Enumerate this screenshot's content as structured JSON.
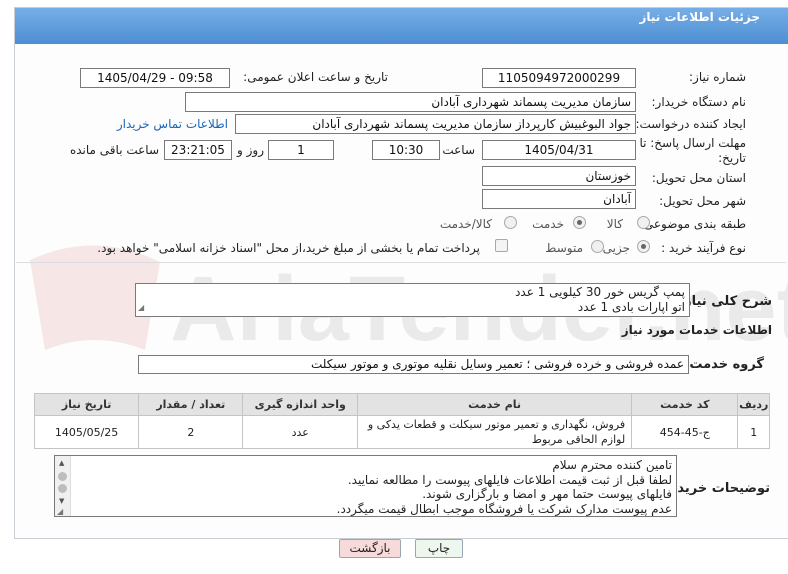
{
  "header": {
    "title": "جزئیات اطلاعات نیاز"
  },
  "labels": {
    "need_number": "شماره نیاز:",
    "announce_datetime": "تاریخ و ساعت اعلان عمومی:",
    "buyer_org": "نام دستگاه خریدار:",
    "requester": "ایجاد کننده درخواست:",
    "contact_link": "اطلاعات تماس خریدار",
    "deadline": "مهلت ارسال پاسخ: تا تاریخ:",
    "time_word": "ساعت",
    "day_and": "روز و",
    "remaining": "ساعت باقی مانده",
    "province": "استان محل تحویل:",
    "city": "شهر محل تحویل:",
    "category": "طبقه بندی موضوعی:",
    "process_type": "نوع فرآیند خرید :",
    "general_desc": "شرح کلی نیاز:",
    "services_info": "اطلاعات خدمات مورد نیاز",
    "service_group": "گروه خدمت:",
    "buyer_notes": "توضیحات خریدار:"
  },
  "fields": {
    "need_number": "1105094972000299",
    "announce_datetime": "1405/04/29 - 09:58",
    "buyer_org": "سازمان مدیریت پسماند شهرداری آبادان",
    "requester": "جواد البوغبیش کارپرداز سازمان مدیریت پسماند شهرداری آبادان",
    "deadline_date": "1405/04/31",
    "deadline_time": "10:30",
    "days": "1",
    "remaining_time": "23:21:05",
    "province": "خوزستان",
    "city": "آبادان",
    "service_group": "عمده فروشی و خرده فروشی ؛ تعمیر وسایل نقلیه موتوری و موتور سیکلت"
  },
  "category_options": [
    {
      "label": "کالا",
      "selected": false
    },
    {
      "label": "خدمت",
      "selected": true
    },
    {
      "label": "کالا/خدمت",
      "selected": false
    }
  ],
  "process_options": [
    {
      "label": "جزیی",
      "selected": true
    },
    {
      "label": "متوسط",
      "selected": false
    }
  ],
  "payment_note": "پرداخت تمام یا بخشی از مبلغ خرید،از محل \"اسناد خزانه اسلامی\" خواهد بود.",
  "general_desc": {
    "line1": "پمپ گریس خور 30 کیلویی 1 عدد",
    "line2": "اتو اپارات بادی 1 عدد"
  },
  "table": {
    "headers": {
      "row": "ردیف",
      "code": "کد خدمت",
      "name": "نام خدمت",
      "unit": "واحد اندازه گیری",
      "qty": "تعداد / مقدار",
      "date": "تاریخ نیاز"
    },
    "rows": [
      {
        "row": "1",
        "code": "ج-45-454",
        "name": "فروش، نگهداری و تعمیر موتور سیکلت و قطعات یدکی و لوازم الحاقی مربوط",
        "unit": "عدد",
        "qty": "2",
        "date": "1405/05/25"
      }
    ]
  },
  "buyer_notes": {
    "l1": "تامین کننده محترم سلام",
    "l2": "لطفا قبل از ثبت قیمت اطلاعات فایلهای پیوست را مطالعه نمایید.",
    "l3": "فایلهای پیوست حتما مهر و امضا و بارگزاری شوند.",
    "l4": "عدم پیوست مدارک شرکت یا فروشگاه موجب ابطال قیمت میگردد."
  },
  "buttons": {
    "print": "چاپ",
    "back": "بازگشت"
  },
  "watermark": "AriaTender.net",
  "colors": {
    "header": "#5b98d8",
    "link": "#1a66b8",
    "back_button": "#f7dada",
    "print_button": "#eef7ee"
  }
}
